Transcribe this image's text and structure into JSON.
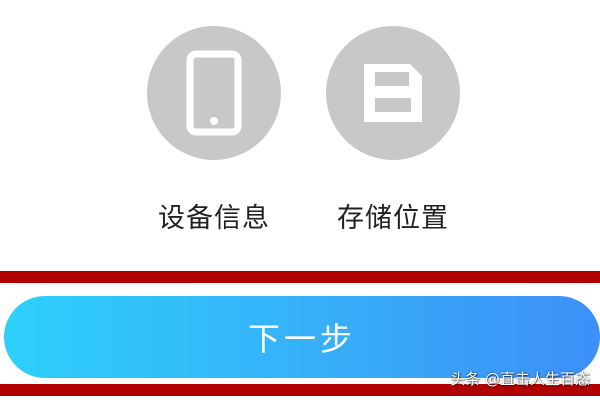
{
  "options": [
    {
      "label": "设备信息",
      "icon": "phone-icon"
    },
    {
      "label": "存储位置",
      "icon": "floppy-disk-icon"
    }
  ],
  "next_button": {
    "label": "下一步"
  },
  "watermark": "头条 @直击人生百态",
  "colors": {
    "icon_circle": "#c8c8c8",
    "button_gradient_start": "#2ed0fb",
    "button_gradient_end": "#3d8ff7",
    "highlight_red": "#b00000",
    "label_text": "#222222"
  }
}
